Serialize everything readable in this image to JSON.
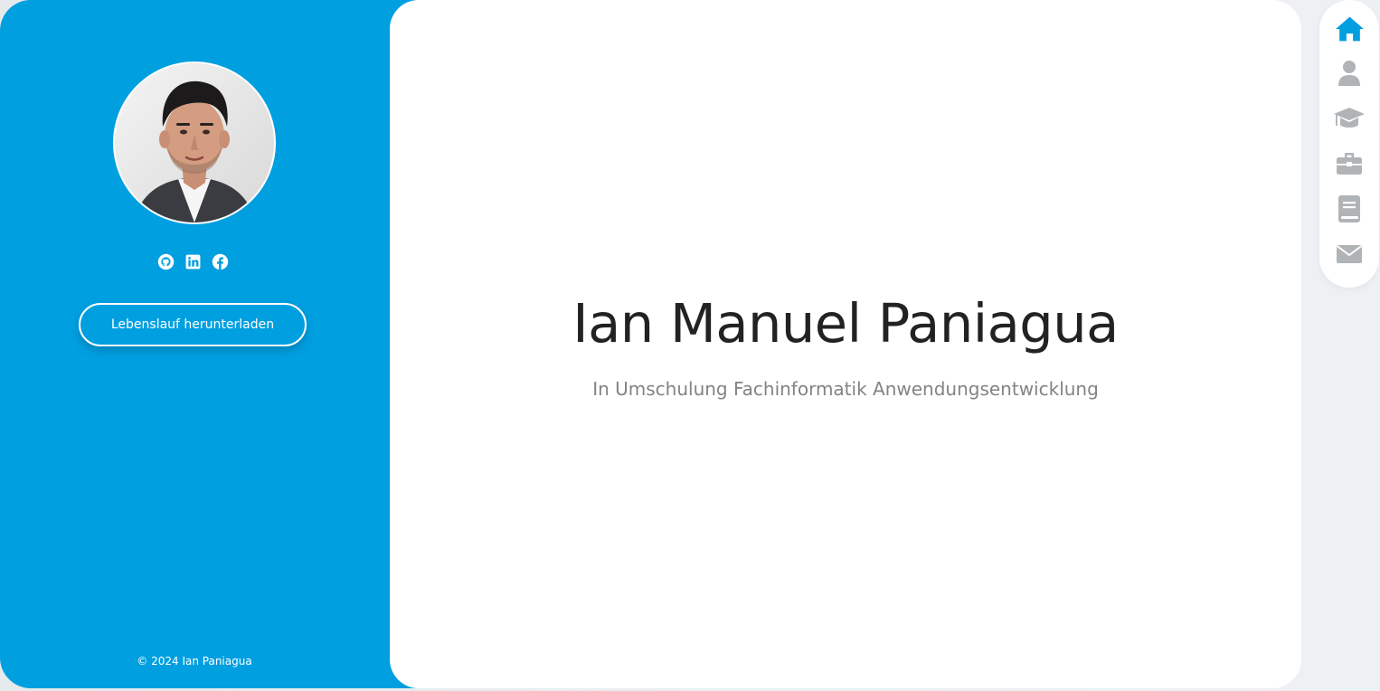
{
  "profile": {
    "avatar": "profile-photo",
    "socials": [
      {
        "icon": "github-icon"
      },
      {
        "icon": "linkedin-icon"
      },
      {
        "icon": "facebook-icon"
      }
    ],
    "cv_button_label": "Lebenslauf herunterladen",
    "copyright": "© 2024 Ian Paniagua"
  },
  "hero": {
    "name": "Ian Manuel Paniagua",
    "subtitle": "In Umschulung Fachinformatik Anwendungsentwicklung"
  },
  "nav": {
    "items": [
      {
        "icon": "home-icon",
        "active": true
      },
      {
        "icon": "user-icon",
        "active": false
      },
      {
        "icon": "graduation-cap-icon",
        "active": false
      },
      {
        "icon": "briefcase-icon",
        "active": false
      },
      {
        "icon": "book-icon",
        "active": false
      },
      {
        "icon": "envelope-icon",
        "active": false
      }
    ]
  },
  "colors": {
    "sidebar": "#009fe0",
    "nav_active": "#009fe0",
    "nav_inactive": "#b0b4b7",
    "heading": "#222222",
    "subtitle": "#838383"
  }
}
